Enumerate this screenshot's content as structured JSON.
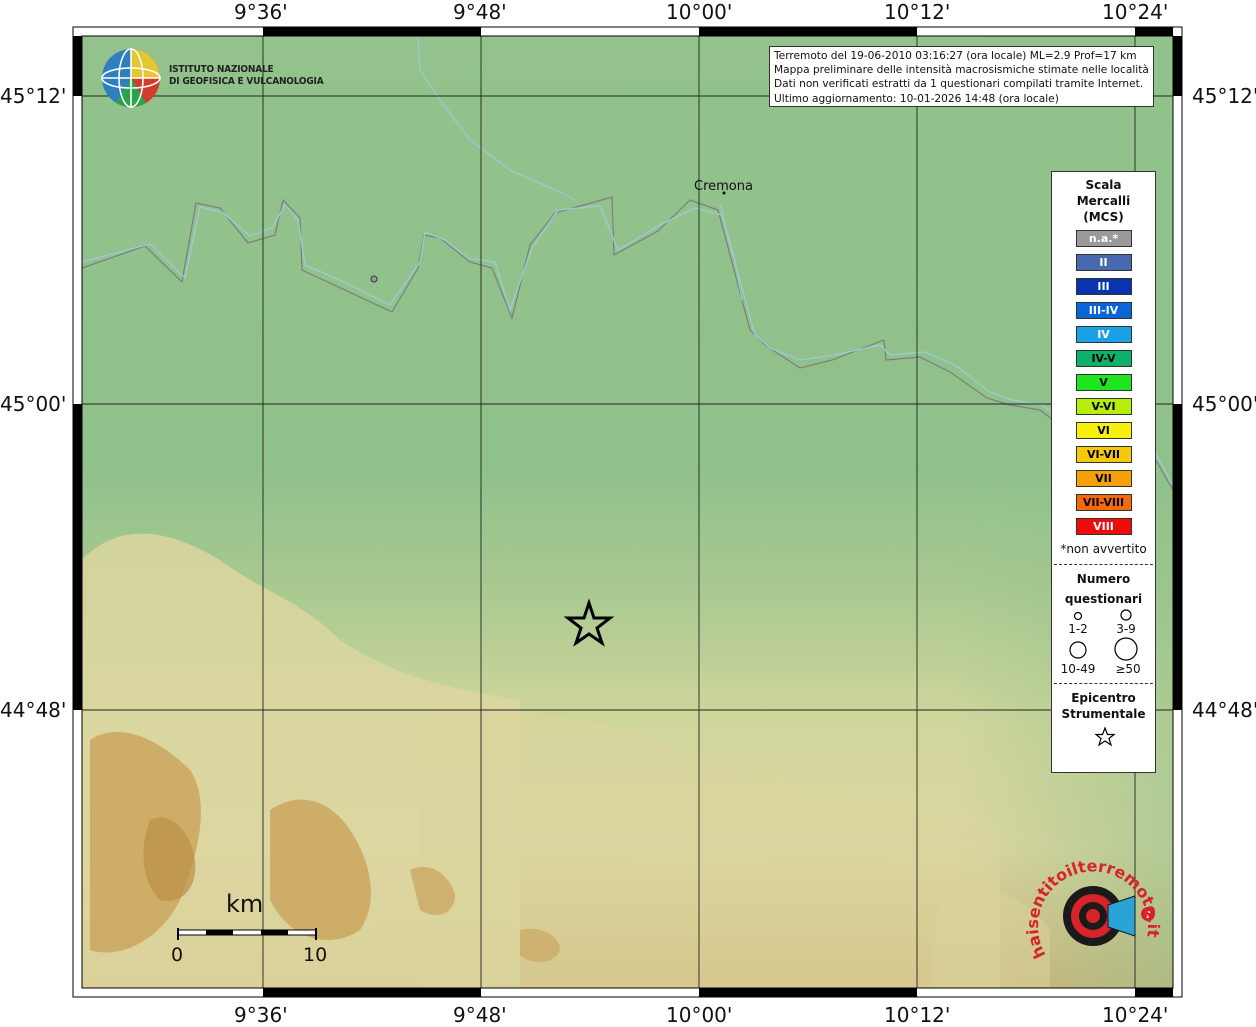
{
  "map": {
    "lon_labels": [
      "9°36'",
      "9°48'",
      "10°00'",
      "10°12'",
      "10°24'"
    ],
    "lat_labels": [
      "45°12'",
      "45°00'",
      "44°48'"
    ]
  },
  "institute": {
    "name_line1": "ISTITUTO NAZIONALE",
    "name_line2": "DI GEOFISICA E VULCANOLOGIA",
    "logo_icon": "ingv-globe-logo"
  },
  "info": {
    "line1": "Terremoto del 19-06-2010 03:16:27 (ora locale) ML=2.9 Prof=17 km",
    "line2": "Mappa preliminare delle intensità macrosismiche stimate nelle località",
    "line3": "Dati non verificati estratti da 1 questionari compilati tramite Internet.",
    "line4": "Ultimo aggiornamento: 10-01-2026 14:48 (ora locale)"
  },
  "places": {
    "city": "Cremona"
  },
  "legend": {
    "title1": "Scala",
    "title2": "Mercalli",
    "title3": "(MCS)",
    "classes": [
      {
        "label": "n.a.*",
        "color": "#9a9a9a",
        "text": "#ffffff"
      },
      {
        "label": "II",
        "color": "#4a68b0",
        "text": "#ffffff"
      },
      {
        "label": "III",
        "color": "#0a33b0",
        "text": "#ffffff"
      },
      {
        "label": "III-IV",
        "color": "#0a66d8",
        "text": "#ffffff"
      },
      {
        "label": "IV",
        "color": "#1aa0e6",
        "text": "#ffffff"
      },
      {
        "label": "IV-V",
        "color": "#0fb06a",
        "text": "#000000"
      },
      {
        "label": "V",
        "color": "#1ee61e",
        "text": "#000000"
      },
      {
        "label": "V-VI",
        "color": "#b4ee0a",
        "text": "#000000"
      },
      {
        "label": "VI",
        "color": "#f6f00a",
        "text": "#000000"
      },
      {
        "label": "VI-VII",
        "color": "#f6c80a",
        "text": "#000000"
      },
      {
        "label": "VII",
        "color": "#f6a00a",
        "text": "#000000"
      },
      {
        "label": "VII-VIII",
        "color": "#f46a0a",
        "text": "#000000"
      },
      {
        "label": "VIII",
        "color": "#f00a0a",
        "text": "#ffffff"
      }
    ],
    "not_felt_note": "*non avvertito",
    "questionnaires_title1": "Numero",
    "questionnaires_title2": "questionari",
    "counts": [
      "1-2",
      "3-9",
      "10-49",
      "≥50"
    ],
    "epicenter_title1": "Epicentro",
    "epicenter_title2": "Strumentale",
    "epicenter_icon": "star-icon"
  },
  "scale_bar": {
    "unit": "km",
    "start": "0",
    "end": "10"
  },
  "badge": {
    "text": "haisentitoilterremoto.it",
    "icon": "megaphone-icon"
  },
  "colors": {
    "plain": "#8fc18b",
    "hills": "#d8d89a",
    "mountains": "#c9a25a",
    "river": "#9ccbd6",
    "border": "#7e7e7e"
  }
}
